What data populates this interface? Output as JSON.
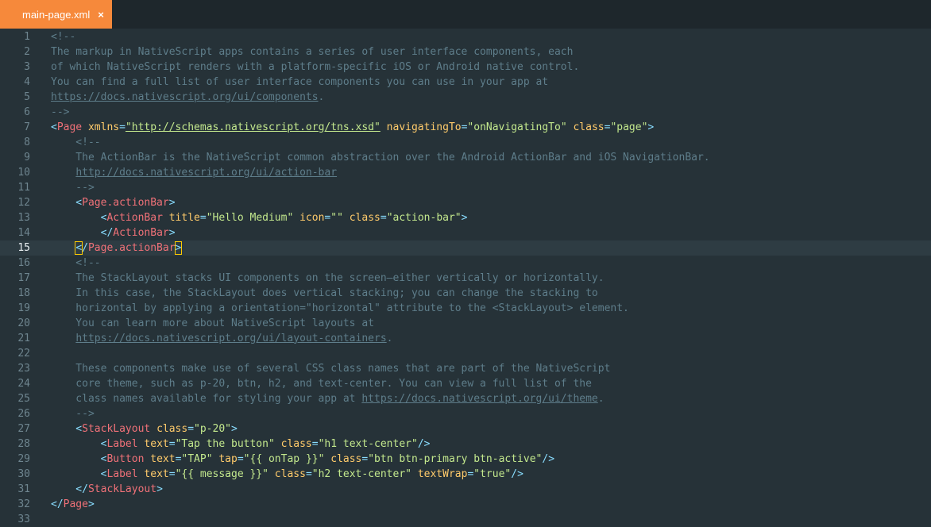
{
  "tab": {
    "filename": "main-page.xml",
    "close_glyph": "×"
  },
  "active_line": 15,
  "lines": [
    {
      "n": "1",
      "code": [
        [
          "c",
          "<!--"
        ]
      ]
    },
    {
      "n": "2",
      "code": [
        [
          "c",
          "The markup in NativeScript apps contains a series of user interface components, each"
        ]
      ]
    },
    {
      "n": "3",
      "code": [
        [
          "c",
          "of which NativeScript renders with a platform-specific iOS or Android native control."
        ]
      ]
    },
    {
      "n": "4",
      "code": [
        [
          "c",
          "You can find a full list of user interface components you can use in your app at"
        ]
      ]
    },
    {
      "n": "5",
      "code": [
        [
          "cu",
          "https://docs.nativescript.org/ui/components"
        ],
        [
          "c",
          "."
        ]
      ]
    },
    {
      "n": "6",
      "code": [
        [
          "c",
          "-->"
        ]
      ]
    },
    {
      "n": "7",
      "code": [
        [
          "p",
          "<"
        ],
        [
          "t",
          "Page"
        ],
        [
          "p",
          " "
        ],
        [
          "a",
          "xmlns"
        ],
        [
          "o",
          "="
        ],
        [
          "su",
          "\"http://schemas.nativescript.org/tns.xsd\""
        ],
        [
          "p",
          " "
        ],
        [
          "a",
          "navigatingTo"
        ],
        [
          "o",
          "="
        ],
        [
          "s",
          "\"onNavigatingTo\""
        ],
        [
          "p",
          " "
        ],
        [
          "a",
          "class"
        ],
        [
          "o",
          "="
        ],
        [
          "s",
          "\"page\""
        ],
        [
          "p",
          ">"
        ]
      ]
    },
    {
      "n": "8",
      "code": [
        [
          "c",
          "    <!--"
        ]
      ]
    },
    {
      "n": "9",
      "code": [
        [
          "c",
          "    The ActionBar is the NativeScript common abstraction over the Android ActionBar and iOS NavigationBar."
        ]
      ]
    },
    {
      "n": "10",
      "code": [
        [
          "c",
          "    "
        ],
        [
          "cu",
          "http://docs.nativescript.org/ui/action-bar"
        ]
      ]
    },
    {
      "n": "11",
      "code": [
        [
          "c",
          "    -->"
        ]
      ]
    },
    {
      "n": "12",
      "code": [
        [
          "p",
          "    <"
        ],
        [
          "t",
          "Page.actionBar"
        ],
        [
          "p",
          ">"
        ]
      ]
    },
    {
      "n": "13",
      "code": [
        [
          "p",
          "        <"
        ],
        [
          "t",
          "ActionBar"
        ],
        [
          "p",
          " "
        ],
        [
          "a",
          "title"
        ],
        [
          "o",
          "="
        ],
        [
          "s",
          "\"Hello Medium\""
        ],
        [
          "p",
          " "
        ],
        [
          "a",
          "icon"
        ],
        [
          "o",
          "="
        ],
        [
          "s",
          "\"\""
        ],
        [
          "p",
          " "
        ],
        [
          "a",
          "class"
        ],
        [
          "o",
          "="
        ],
        [
          "s",
          "\"action-bar\""
        ],
        [
          "p",
          ">"
        ]
      ]
    },
    {
      "n": "14",
      "code": [
        [
          "p",
          "        </"
        ],
        [
          "t",
          "ActionBar"
        ],
        [
          "p",
          ">"
        ]
      ]
    },
    {
      "n": "15",
      "code": [
        [
          "p",
          "    "
        ],
        [
          "cur",
          "<"
        ],
        [
          "p",
          "/"
        ],
        [
          "t",
          "Page.actionBar"
        ],
        [
          "cur",
          ">"
        ]
      ]
    },
    {
      "n": "16",
      "code": [
        [
          "c",
          "    <!--"
        ]
      ]
    },
    {
      "n": "17",
      "code": [
        [
          "c",
          "    The StackLayout stacks UI components on the screen—either vertically or horizontally."
        ]
      ]
    },
    {
      "n": "18",
      "code": [
        [
          "c",
          "    In this case, the StackLayout does vertical stacking; you can change the stacking to"
        ]
      ]
    },
    {
      "n": "19",
      "code": [
        [
          "c",
          "    horizontal by applying a orientation=\"horizontal\" attribute to the <StackLayout> element."
        ]
      ]
    },
    {
      "n": "20",
      "code": [
        [
          "c",
          "    You can learn more about NativeScript layouts at"
        ]
      ]
    },
    {
      "n": "21",
      "code": [
        [
          "c",
          "    "
        ],
        [
          "cu",
          "https://docs.nativescript.org/ui/layout-containers"
        ],
        [
          "c",
          "."
        ]
      ]
    },
    {
      "n": "22",
      "code": []
    },
    {
      "n": "23",
      "code": [
        [
          "c",
          "    These components make use of several CSS class names that are part of the NativeScript"
        ]
      ]
    },
    {
      "n": "24",
      "code": [
        [
          "c",
          "    core theme, such as p-20, btn, h2, and text-center. You can view a full list of the"
        ]
      ]
    },
    {
      "n": "25",
      "code": [
        [
          "c",
          "    class names available for styling your app at "
        ],
        [
          "cu",
          "https://docs.nativescript.org/ui/theme"
        ],
        [
          "c",
          "."
        ]
      ]
    },
    {
      "n": "26",
      "code": [
        [
          "c",
          "    -->"
        ]
      ]
    },
    {
      "n": "27",
      "code": [
        [
          "p",
          "    <"
        ],
        [
          "t",
          "StackLayout"
        ],
        [
          "p",
          " "
        ],
        [
          "a",
          "class"
        ],
        [
          "o",
          "="
        ],
        [
          "s",
          "\"p-20\""
        ],
        [
          "p",
          ">"
        ]
      ]
    },
    {
      "n": "28",
      "code": [
        [
          "p",
          "        <"
        ],
        [
          "t",
          "Label"
        ],
        [
          "p",
          " "
        ],
        [
          "a",
          "text"
        ],
        [
          "o",
          "="
        ],
        [
          "s",
          "\"Tap the button\""
        ],
        [
          "p",
          " "
        ],
        [
          "a",
          "class"
        ],
        [
          "o",
          "="
        ],
        [
          "s",
          "\"h1 text-center\""
        ],
        [
          "p",
          "/>"
        ]
      ]
    },
    {
      "n": "29",
      "code": [
        [
          "p",
          "        <"
        ],
        [
          "t",
          "Button"
        ],
        [
          "p",
          " "
        ],
        [
          "a",
          "text"
        ],
        [
          "o",
          "="
        ],
        [
          "s",
          "\"TAP\""
        ],
        [
          "p",
          " "
        ],
        [
          "a",
          "tap"
        ],
        [
          "o",
          "="
        ],
        [
          "s",
          "\"{{ onTap }}\""
        ],
        [
          "p",
          " "
        ],
        [
          "a",
          "class"
        ],
        [
          "o",
          "="
        ],
        [
          "s",
          "\"btn btn-primary btn-active\""
        ],
        [
          "p",
          "/>"
        ]
      ]
    },
    {
      "n": "30",
      "code": [
        [
          "p",
          "        <"
        ],
        [
          "t",
          "Label"
        ],
        [
          "p",
          " "
        ],
        [
          "a",
          "text"
        ],
        [
          "o",
          "="
        ],
        [
          "s",
          "\"{{ message }}\""
        ],
        [
          "p",
          " "
        ],
        [
          "a",
          "class"
        ],
        [
          "o",
          "="
        ],
        [
          "s",
          "\"h2 text-center\""
        ],
        [
          "p",
          " "
        ],
        [
          "a",
          "textWrap"
        ],
        [
          "o",
          "="
        ],
        [
          "s",
          "\"true\""
        ],
        [
          "p",
          "/>"
        ]
      ]
    },
    {
      "n": "31",
      "code": [
        [
          "p",
          "    </"
        ],
        [
          "t",
          "StackLayout"
        ],
        [
          "p",
          ">"
        ]
      ]
    },
    {
      "n": "32",
      "code": [
        [
          "p",
          "</"
        ],
        [
          "t",
          "Page"
        ],
        [
          "p",
          ">"
        ]
      ]
    },
    {
      "n": "33",
      "code": []
    }
  ]
}
